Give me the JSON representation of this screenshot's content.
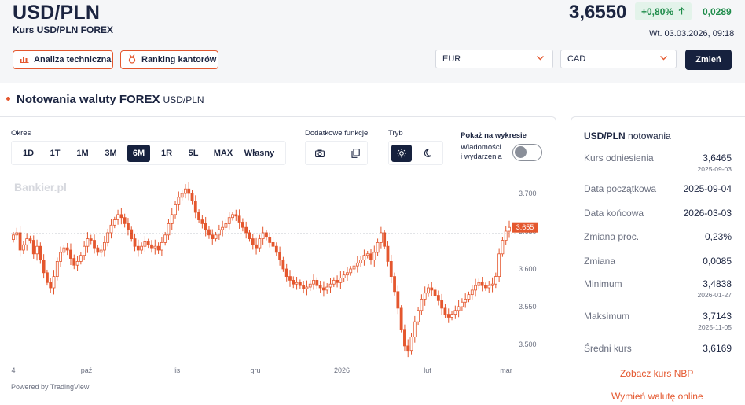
{
  "header": {
    "pair": "USD/PLN",
    "subtitle": "Kurs USD/PLN FOREX",
    "price": "3,6550",
    "change_pct": "+0,80%",
    "change_abs": "0,0289",
    "datetime": "Wt. 03.03.2026, 09:18",
    "btn_analysis": "Analiza techniczna",
    "btn_ranking": "Ranking kantorów",
    "select_from": "EUR",
    "select_to": "CAD",
    "btn_change": "Zmień"
  },
  "section": {
    "title": "Notowania waluty FOREX",
    "subtitle": "USD/PLN"
  },
  "controls": {
    "period_label": "Okres",
    "periods": [
      "1D",
      "1T",
      "1M",
      "3M",
      "6M",
      "1R",
      "5L",
      "MAX",
      "Własny"
    ],
    "active_period": "6M",
    "extra_label": "Dodatkowe funkcje",
    "mode_label": "Tryb",
    "show_label": "Pokaż na wykresie",
    "events_line1": "Wiadomości",
    "events_line2": "i wydarzenia",
    "events_enabled": false
  },
  "chart_data": {
    "type": "candlestick",
    "watermark": "Bankier.pl",
    "last_price_label": "3.655",
    "reference_line": 3.6465,
    "ylim": [
      3.475,
      3.725
    ],
    "yticks": [
      "3.700",
      "3.650",
      "3.600",
      "3.550",
      "3.500"
    ],
    "xticks": [
      "4",
      "paź",
      "lis",
      "gru",
      "2026",
      "lut",
      "mar"
    ],
    "powered_by": "Powered by TradingView",
    "colors": {
      "candle": "#e4572e",
      "last_label_bg": "#e4572e"
    },
    "close_path": [
      3.645,
      3.648,
      3.625,
      3.632,
      3.64,
      3.638,
      3.62,
      3.63,
      3.612,
      3.595,
      3.582,
      3.575,
      3.59,
      3.61,
      3.622,
      3.628,
      3.625,
      3.614,
      3.605,
      3.61,
      3.618,
      3.63,
      3.64,
      3.638,
      3.628,
      3.622,
      3.625,
      3.635,
      3.648,
      3.658,
      3.665,
      3.672,
      3.668,
      3.66,
      3.652,
      3.64,
      3.63,
      3.625,
      3.63,
      3.636,
      3.632,
      3.628,
      3.63,
      3.625,
      3.635,
      3.645,
      3.66,
      3.672,
      3.685,
      3.695,
      3.7,
      3.706,
      3.7,
      3.69,
      3.675,
      3.665,
      3.66,
      3.652,
      3.645,
      3.64,
      3.645,
      3.652,
      3.655,
      3.66,
      3.668,
      3.672,
      3.67,
      3.662,
      3.655,
      3.648,
      3.64,
      3.632,
      3.628,
      3.64,
      3.648,
      3.642,
      3.635,
      3.63,
      3.622,
      3.612,
      3.6,
      3.59,
      3.585,
      3.58,
      3.582,
      3.578,
      3.574,
      3.576,
      3.58,
      3.585,
      3.578,
      3.575,
      3.572,
      3.576,
      3.58,
      3.585,
      3.582,
      3.588,
      3.592,
      3.595,
      3.6,
      3.604,
      3.608,
      3.612,
      3.618,
      3.62,
      3.612,
      3.622,
      3.635,
      3.648,
      3.63,
      3.61,
      3.59,
      3.57,
      3.548,
      3.52,
      3.498,
      3.492,
      3.51,
      3.53,
      3.545,
      3.56,
      3.568,
      3.575,
      3.572,
      3.565,
      3.558,
      3.548,
      3.54,
      3.536,
      3.54,
      3.545,
      3.55,
      3.556,
      3.56,
      3.566,
      3.572,
      3.578,
      3.582,
      3.578,
      3.575,
      3.578,
      3.58,
      3.59,
      3.62,
      3.638,
      3.65,
      3.655
    ]
  },
  "stats": {
    "title": "USD/PLN",
    "title_suffix": "notowania",
    "rows": [
      {
        "label": "Kurs odniesienia",
        "value": "3,6465",
        "date": "2025-09-03"
      },
      {
        "label": "Data początkowa",
        "value": "2025-09-04",
        "date": ""
      },
      {
        "label": "Data końcowa",
        "value": "2026-03-03",
        "date": ""
      },
      {
        "label": "Zmiana proc.",
        "value": "0,23%",
        "date": ""
      },
      {
        "label": "Zmiana",
        "value": "0,0085",
        "date": ""
      },
      {
        "label": "Minimum",
        "value": "3,4838",
        "date": "2026-01-27"
      },
      {
        "label": "Maksimum",
        "value": "3,7143",
        "date": "2025-11-05"
      },
      {
        "label": "Średni kurs",
        "value": "3,6169",
        "date": ""
      }
    ],
    "link_nbp": "Zobacz kurs NBP",
    "link_exchange": "Wymień walutę online"
  }
}
